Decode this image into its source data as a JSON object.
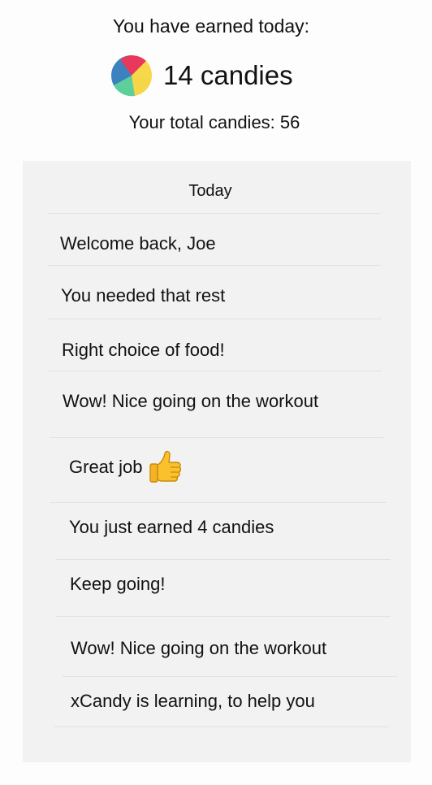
{
  "header": {
    "earned_label": "You have earned today:",
    "earned_count": "14 candies",
    "total_label": "Your total candies: 56",
    "candy_icon": "candy-ball-icon",
    "candy_colors": [
      "#e8395c",
      "#f7d84a",
      "#5dcf9a",
      "#3b82bf"
    ]
  },
  "feed": {
    "header": "Today",
    "messages": [
      {
        "text": "Welcome back, Joe"
      },
      {
        "text": "You needed that rest"
      },
      {
        "text": "Right choice of food!"
      },
      {
        "text": "Wow! Nice going on the workout"
      },
      {
        "text": "Great job",
        "icon": "thumbs-up-icon"
      },
      {
        "text": "You just earned 4 candies"
      },
      {
        "text": "Keep going!"
      },
      {
        "text": "Wow! Nice going on the workout"
      },
      {
        "text": "xCandy is learning, to help you"
      }
    ]
  }
}
